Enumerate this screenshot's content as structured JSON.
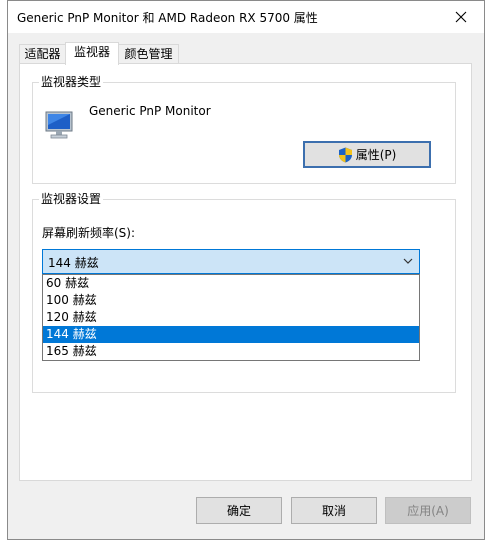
{
  "window": {
    "title": "Generic PnP Monitor 和 AMD Radeon RX 5700 属性",
    "close_icon": "close-icon"
  },
  "tabs": [
    {
      "label": "适配器",
      "active": false
    },
    {
      "label": "监视器",
      "active": true
    },
    {
      "label": "颜色管理",
      "active": false
    }
  ],
  "monitor_type": {
    "legend": "监视器类型",
    "monitor_name": "Generic PnP Monitor",
    "monitor_icon": "monitor-icon",
    "properties_button": "属性(P)",
    "properties_icon": "uac-shield-icon"
  },
  "monitor_settings": {
    "legend": "监视器设置",
    "refresh_label": "屏幕刷新频率(S):",
    "selected_value": "144 赫兹",
    "options": [
      "60 赫兹",
      "100 赫兹",
      "120 赫兹",
      "144 赫兹",
      "165 赫兹"
    ],
    "selected_index": 3
  },
  "footer": {
    "ok": "确定",
    "cancel": "取消",
    "apply": "应用(A)"
  },
  "colors": {
    "accent": "#0078d7",
    "dropdown_bg": "#cce4f7",
    "selection_text": "#ffffff"
  }
}
